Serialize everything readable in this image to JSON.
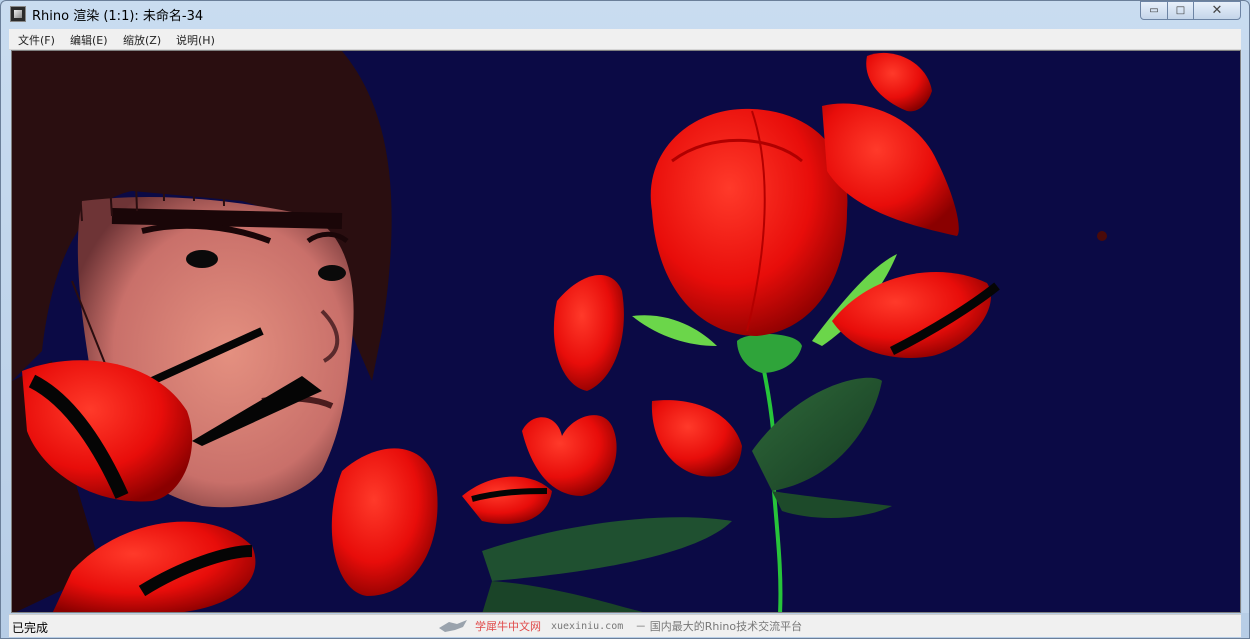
{
  "window": {
    "title": "Rhino 渲染 (1:1): 未命名-34",
    "app_icon": "rhino-render-icon",
    "controls": {
      "minimize": "▭",
      "maximize": "□",
      "close": "✕"
    }
  },
  "menubar": {
    "items": [
      {
        "label": "文件(F)"
      },
      {
        "label": "编辑(E)"
      },
      {
        "label": "缩放(Z)"
      },
      {
        "label": "说明(H)"
      }
    ]
  },
  "viewport": {
    "background": "#0b0a45",
    "scene": "rendered-image"
  },
  "statusbar": {
    "status": "已完成"
  },
  "watermark": {
    "brand": "学犀牛中文网",
    "url": "xuexiniu.com",
    "slogan": "－ 国内最大的Rhino技术交流平台"
  }
}
